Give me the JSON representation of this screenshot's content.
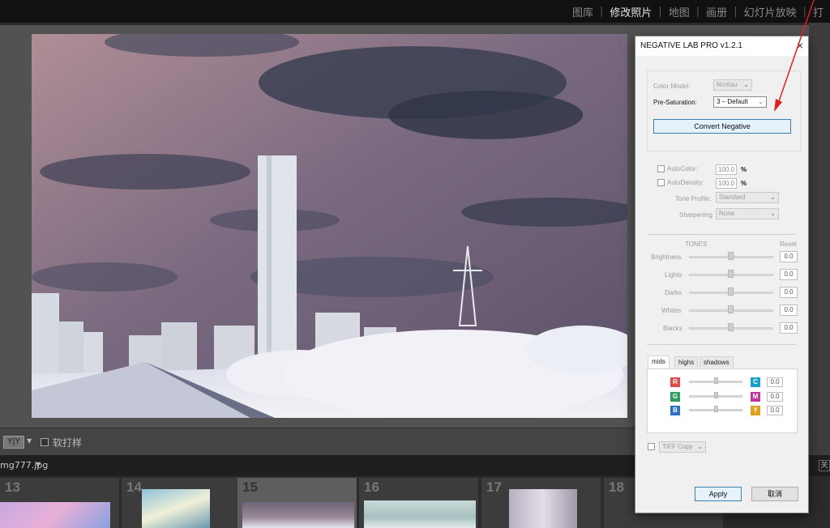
{
  "app": {
    "modules": [
      "图库",
      "修改照片",
      "地图",
      "画册",
      "幻灯片放映",
      "打"
    ],
    "active_module": "修改照片"
  },
  "toolbar": {
    "view_mode_label": "Y|Y",
    "soft_proof_label": "软打样"
  },
  "filmstrip": {
    "filename": "mg777.jpg",
    "close_label": "关",
    "cells": [
      {
        "number": "13"
      },
      {
        "number": "14"
      },
      {
        "number": "15",
        "selected": true
      },
      {
        "number": "16"
      },
      {
        "number": "17"
      },
      {
        "number": "18"
      }
    ]
  },
  "dialog": {
    "title": "NEGATIVE LAB PRO v1.2.1",
    "close_icon": "×",
    "color_model_label": "Color Model:",
    "color_model_value": "Noritsu",
    "pre_saturation_label": "Pre-Saturation:",
    "pre_saturation_value": "3 – Default",
    "convert_label": "Convert Negative",
    "autocolor_label": "AutoColor:",
    "autocolor_value": "100.0",
    "autodensity_label": "AutoDensity:",
    "autodensity_value": "100.0",
    "percent": "%",
    "tone_profile_label": "Tone Profile:",
    "tone_profile_value": "Standard",
    "sharpening_label": "Sharpening",
    "sharpening_value": "None",
    "tones_label": "TONES",
    "reset_label": "Reset",
    "tones": [
      {
        "label": "Brightness",
        "value": "0.0"
      },
      {
        "label": "Lights",
        "value": "0.0"
      },
      {
        "label": "Darks",
        "value": "0.0"
      },
      {
        "label": "Whites",
        "value": "0.0"
      },
      {
        "label": "Blacks",
        "value": "0.0"
      }
    ],
    "tabs": [
      "mids",
      "highs",
      "shadows"
    ],
    "active_tab": "mids",
    "color_rows": [
      {
        "left": "R",
        "right": "C",
        "value": "0.0",
        "left_color": "#e24b4b",
        "right_color": "#1aa0c8"
      },
      {
        "left": "G",
        "right": "M",
        "value": "0.0",
        "left_color": "#2f9e5b",
        "right_color": "#c0359a"
      },
      {
        "left": "B",
        "right": "Y",
        "value": "0.0",
        "left_color": "#2b6fc6",
        "right_color": "#e0a020"
      }
    ],
    "tiff_label": "TIFF Copy",
    "apply_label": "Apply",
    "cancel_label": "取消"
  },
  "colors": {
    "annotation_arrow": "#e02020",
    "convert_border": "#3c7fb1"
  }
}
